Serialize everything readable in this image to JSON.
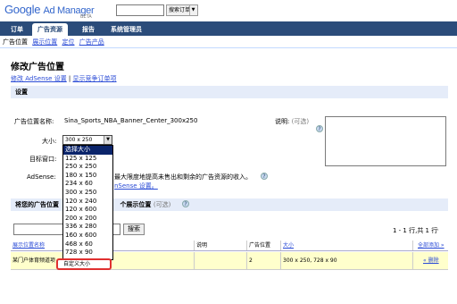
{
  "header": {
    "logo_google": "Google",
    "logo_product": "Ad Manager",
    "beta": "BETA",
    "search_placeholder": "",
    "search_scope": "搜索订单"
  },
  "nav": {
    "tabs": [
      {
        "label": "订单",
        "active": false
      },
      {
        "label": "广告资源",
        "active": true
      },
      {
        "label": "报告",
        "active": false
      },
      {
        "label": "系统管理员",
        "active": false
      }
    ]
  },
  "subnav": {
    "items": [
      "广告位置",
      "展示位置",
      "定位",
      "广告产品"
    ]
  },
  "page": {
    "title": "修改广告位置",
    "link1": "修改 AdSense 设置",
    "link2": "显示竞争订单项"
  },
  "settings": {
    "section_title": "设置",
    "name_label": "广告位置名称:",
    "name_value": "Sina_Sports_NBA_Banner_Center_300x250",
    "desc_label": "说明:",
    "desc_optional": "(可选)",
    "size_label": "大小:",
    "size_value": "300 x 250",
    "target_label": "目标窗口:",
    "adsense_label": "AdSense:",
    "adsense_text": "最大限度地提高未售出和剩余的广告资源的收入。",
    "adsense_text2": "nSense 设置。",
    "help": "?",
    "size_options": [
      "选择大小",
      "125 x 125",
      "250 x 250",
      "180 x 150",
      "234 x 60",
      "300 x 250",
      "120 x 240",
      "120 x 600",
      "200 x 200",
      "336 x 280",
      "160 x 600",
      "468 x 60",
      "728 x 90"
    ],
    "custom_size": "自定义大小"
  },
  "placements": {
    "section_title_a": "将您的广告位置",
    "section_title_b": "个展示位置",
    "optional": "(可选)",
    "search_button": "搜索",
    "pagination": "1 - 1 行,共 1 行",
    "columns": {
      "name": "展示位置名称",
      "desc": "说明",
      "count": "广告位置",
      "size": "大小",
      "addall": "全部添加 »"
    },
    "rows": [
      {
        "name": "某门户体育频道项",
        "desc": "",
        "count": "2",
        "size": "300 x 250, 728 x 90",
        "action": "« 删除"
      }
    ]
  }
}
